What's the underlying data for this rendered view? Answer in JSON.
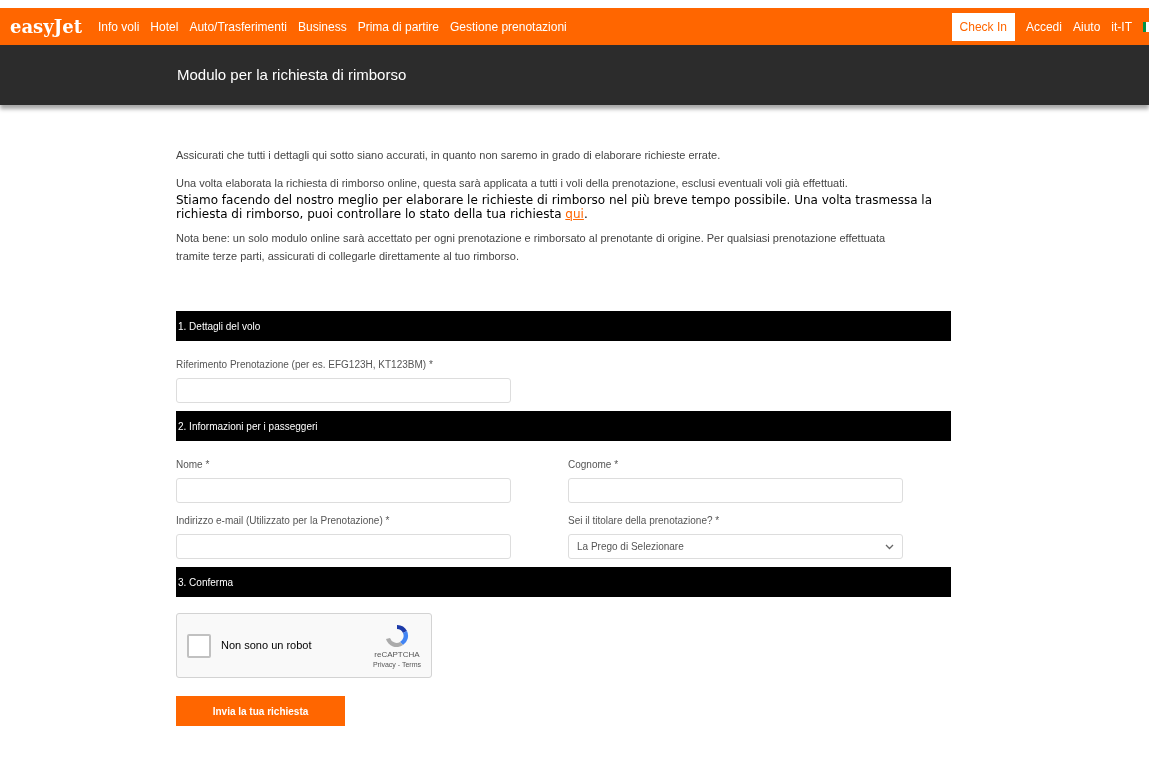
{
  "nav": {
    "logo": "easyJet",
    "links": [
      "Info voli",
      "Hotel",
      "Auto/Trasferimenti",
      "Business",
      "Prima di partire",
      "Gestione prenotazioni"
    ],
    "check_in": "Check In",
    "right_links": [
      "Accedi",
      "Aiuto"
    ],
    "locale": "it-IT"
  },
  "page_title": "Modulo per la richiesta di rimborso",
  "intro": [
    "Assicurati che tutti i dettagli qui sotto siano accurati, in quanto non saremo in grado di elaborare richieste errate.",
    "Una volta elaborata la richiesta di rimborso online, questa sarà applicata a tutti i voli della prenotazione, esclusi eventuali voli già effettuati."
  ],
  "notice": {
    "text": "Stiamo facendo del nostro meglio per elaborare le richieste di rimborso nel più breve tempo possibile. Una volta trasmessa la richiesta di rimborso, puoi controllare lo stato della tua richiesta",
    "link": "qui",
    "end": "."
  },
  "note": "Nota bene: un solo modulo online sarà accettato per ogni prenotazione e rimborsato al prenotante di origine. Per qualsiasi prenotazione effettuata tramite terze parti, assicurati di collegarle direttamente al tuo rimborso.",
  "sections": [
    {
      "title": "1. Dettagli del volo",
      "fields": [
        {
          "kind": "text",
          "label": "Riferimento Prenotazione (per es. EFG123H, KT123BM) *"
        }
      ]
    },
    {
      "title": "2. Informazioni per i passeggeri",
      "fields": [
        {
          "kind": "text",
          "label": "Nome *"
        },
        {
          "kind": "text",
          "label": "Cognome *"
        },
        {
          "kind": "text",
          "label": "Indirizzo e-mail (Utilizzato per la Prenotazione) *"
        },
        {
          "kind": "select",
          "label": "Sei il titolare della prenotazione? *",
          "value": "La Prego di Selezionare"
        }
      ]
    },
    {
      "title": "3. Conferma"
    }
  ],
  "captcha": {
    "label": "Non sono un robot",
    "checked": false,
    "brand": "reCAPTCHA",
    "links": "Privacy - Terms"
  },
  "submit": "Invia la tua richiesta"
}
